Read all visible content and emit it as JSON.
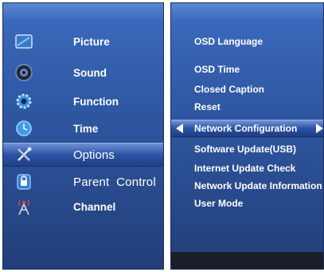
{
  "left_menu": {
    "items": [
      {
        "label": "Picture",
        "icon": "picture-icon"
      },
      {
        "label": "Sound",
        "icon": "sound-icon"
      },
      {
        "label": "Function",
        "icon": "gear-icon"
      },
      {
        "label": "Time",
        "icon": "clock-icon"
      },
      {
        "label": "Options",
        "icon": "tools-icon",
        "selected": true
      },
      {
        "label": "Parent  Control",
        "icon": "lock-icon"
      },
      {
        "label": "Channel",
        "icon": "antenna-icon"
      }
    ]
  },
  "right_menu": {
    "items": [
      {
        "label": "OSD Language"
      },
      {
        "label": "OSD Time"
      },
      {
        "label": "Closed Caption"
      },
      {
        "label": "Reset"
      },
      {
        "label": "Network Configuration",
        "selected": true
      },
      {
        "label": "Software Update(USB)"
      },
      {
        "label": "Internet Update Check"
      },
      {
        "label": "Network Update Information"
      },
      {
        "label": "User Mode"
      }
    ]
  },
  "colors": {
    "panel": "#315ca9",
    "selected": "#2a54a6",
    "text": "#ffffff",
    "bottom_strip": "#1a1e29"
  }
}
